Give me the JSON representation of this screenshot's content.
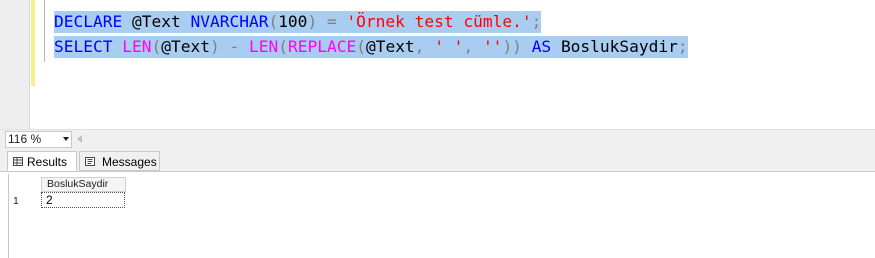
{
  "editor": {
    "line1": [
      {
        "t": "DECLARE",
        "c": "kw"
      },
      {
        "t": " ",
        "c": "tx"
      },
      {
        "t": "@Text",
        "c": "tx"
      },
      {
        "t": " ",
        "c": "tx"
      },
      {
        "t": "NVARCHAR",
        "c": "kw"
      },
      {
        "t": "(",
        "c": "op"
      },
      {
        "t": "100",
        "c": "tx"
      },
      {
        "t": ")",
        "c": "op"
      },
      {
        "t": " = ",
        "c": "op"
      },
      {
        "t": "'Örnek test cümle.'",
        "c": "str"
      },
      {
        "t": ";",
        "c": "op"
      }
    ],
    "line2": [
      {
        "t": "SELECT",
        "c": "kw"
      },
      {
        "t": " ",
        "c": "tx"
      },
      {
        "t": "LEN",
        "c": "fn"
      },
      {
        "t": "(",
        "c": "op"
      },
      {
        "t": "@Text",
        "c": "tx"
      },
      {
        "t": ")",
        "c": "op"
      },
      {
        "t": " - ",
        "c": "op"
      },
      {
        "t": "LEN",
        "c": "fn"
      },
      {
        "t": "(",
        "c": "op"
      },
      {
        "t": "REPLACE",
        "c": "fn"
      },
      {
        "t": "(",
        "c": "op"
      },
      {
        "t": "@Text",
        "c": "tx"
      },
      {
        "t": ", ",
        "c": "op"
      },
      {
        "t": "' '",
        "c": "str"
      },
      {
        "t": ", ",
        "c": "op"
      },
      {
        "t": "''",
        "c": "str"
      },
      {
        "t": "))",
        "c": "op"
      },
      {
        "t": " ",
        "c": "tx"
      },
      {
        "t": "AS",
        "c": "kw"
      },
      {
        "t": " ",
        "c": "tx"
      },
      {
        "t": "BoslukSaydir",
        "c": "tx"
      },
      {
        "t": ";",
        "c": "op"
      }
    ]
  },
  "zoom": {
    "value": "116 %"
  },
  "tabs": {
    "results_label": "Results",
    "messages_label": "Messages"
  },
  "grid": {
    "columns": [
      "BoslukSaydir"
    ],
    "rows": [
      {
        "row_number": "1",
        "cells": [
          "2"
        ]
      }
    ]
  },
  "colors": {
    "keyword": "#0000ff",
    "function": "#ff00ff",
    "operator": "#808080",
    "string": "#ff0000",
    "selection": "#a8cdf0",
    "change_bar": "#f7f08a"
  }
}
